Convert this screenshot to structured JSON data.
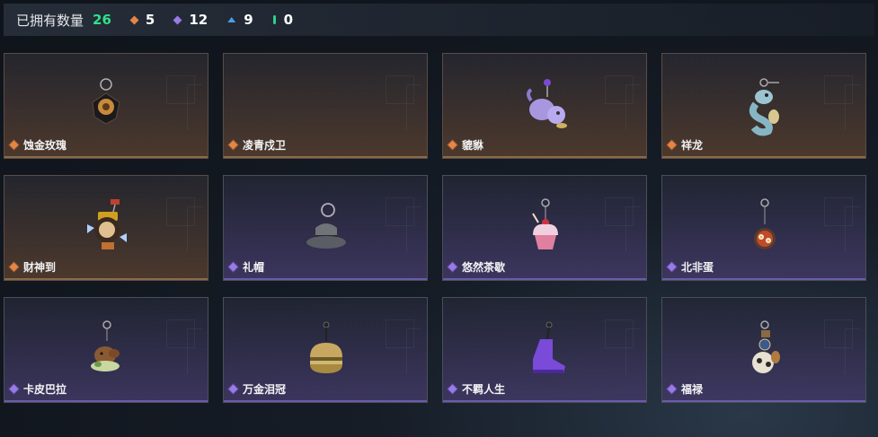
{
  "header": {
    "owned_label": "已拥有数量",
    "owned_count": "26",
    "stats": [
      {
        "icon": "orange-gem-icon",
        "color": "#e58645",
        "value": "5"
      },
      {
        "icon": "purple-gem-icon",
        "color": "#9a7ae6",
        "value": "12"
      },
      {
        "icon": "blue-gem-icon",
        "color": "#4a9ee6",
        "value": "9"
      },
      {
        "icon": "green-gem-icon",
        "color": "#2fd08a",
        "value": "0"
      }
    ]
  },
  "items": [
    {
      "name": "蚀金玫瑰",
      "rarity": "orange",
      "icon": "gold-rose-pendant-icon"
    },
    {
      "name": "凌青戍卫",
      "rarity": "orange",
      "icon": "empty-slot"
    },
    {
      "name": "貔貅",
      "rarity": "orange",
      "icon": "pixiu-pendant-icon"
    },
    {
      "name": "祥龙",
      "rarity": "orange",
      "icon": "dragon-pendant-icon"
    },
    {
      "name": "财神到",
      "rarity": "orange",
      "icon": "fortune-god-pendant-icon"
    },
    {
      "name": "礼帽",
      "rarity": "purple",
      "icon": "top-hat-pendant-icon"
    },
    {
      "name": "悠然茶歇",
      "rarity": "purple",
      "icon": "cupcake-pendant-icon"
    },
    {
      "name": "北非蛋",
      "rarity": "purple",
      "icon": "shakshuka-pendant-icon"
    },
    {
      "name": "卡皮巴拉",
      "rarity": "purple",
      "icon": "capybara-pendant-icon"
    },
    {
      "name": "万金泪冠",
      "rarity": "purple",
      "icon": "burger-pendant-icon"
    },
    {
      "name": "不羁人生",
      "rarity": "purple",
      "icon": "sneaker-pendant-icon"
    },
    {
      "name": "福禄",
      "rarity": "purple",
      "icon": "lucky-charm-pendant-icon"
    }
  ]
}
